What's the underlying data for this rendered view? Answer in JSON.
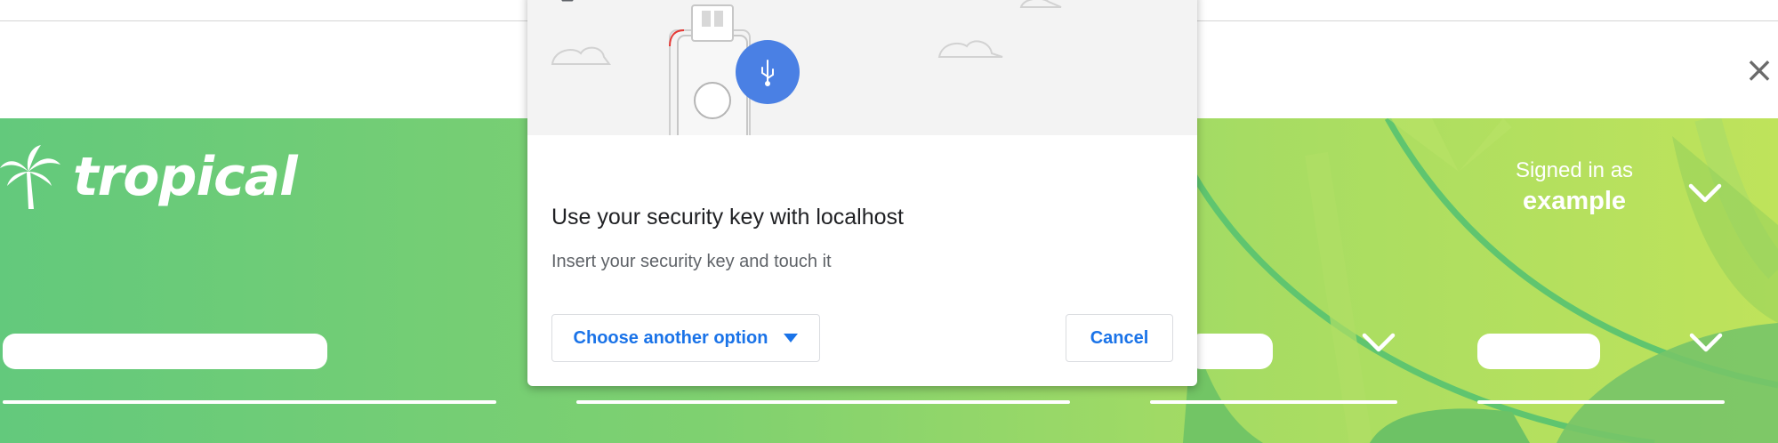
{
  "browser": {
    "close_icon": "close-icon",
    "close_glyph": "×"
  },
  "site": {
    "logo_text": "tropical",
    "logo_icon": "palm-tree-icon",
    "signed_in_label": "Signed in as",
    "signed_in_name": "example"
  },
  "dialog": {
    "back_icon": "back-arrow-icon",
    "title": "Use your security key with localhost",
    "subtitle": "Insert your security key and touch it",
    "choose_label": "Choose another option",
    "cancel_label": "Cancel"
  },
  "colors": {
    "hero_start": "#63c97c",
    "hero_end": "#bfe35b",
    "accent_blue": "#1a73e8",
    "usb_circle": "#4a80e4",
    "illustration_bg": "#f3f3f3"
  }
}
